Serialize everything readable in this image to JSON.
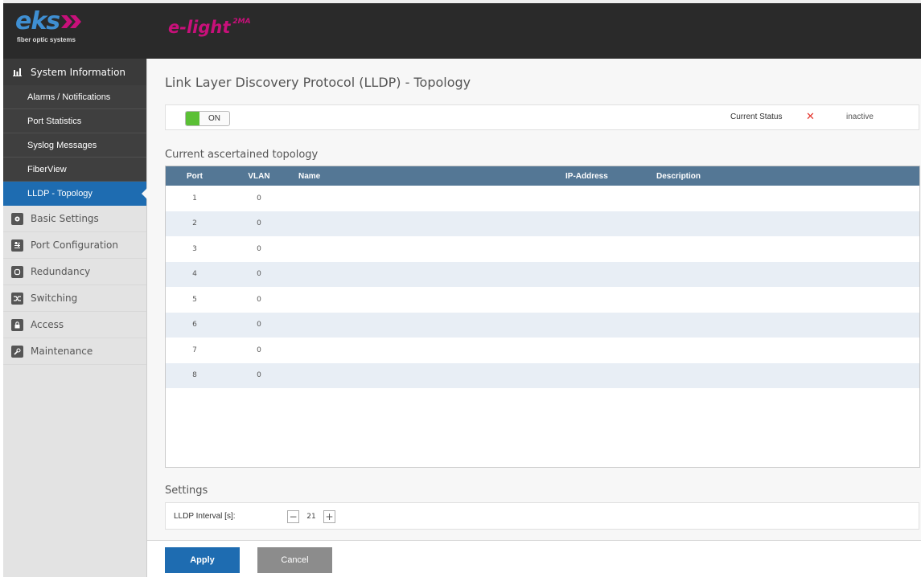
{
  "brand": {
    "logo_text": "eks",
    "logo_tagline": "fiber optic systems",
    "product_name": "e-light",
    "product_suffix": "2MA"
  },
  "sidebar": {
    "sections": [
      {
        "label": "System Information",
        "icon": "bar-chart-icon",
        "active": true
      },
      {
        "label": "Basic Settings",
        "icon": "gear-icon"
      },
      {
        "label": "Port Configuration",
        "icon": "sliders-icon"
      },
      {
        "label": "Redundancy",
        "icon": "loop-icon"
      },
      {
        "label": "Switching",
        "icon": "shuffle-icon"
      },
      {
        "label": "Access",
        "icon": "lock-icon"
      },
      {
        "label": "Maintenance",
        "icon": "wrench-icon"
      }
    ],
    "sub_items": [
      {
        "label": "Alarms / Notifications"
      },
      {
        "label": "Port Statistics"
      },
      {
        "label": "Syslog Messages"
      },
      {
        "label": "FiberView"
      },
      {
        "label": "LLDP - Topology",
        "active": true
      }
    ]
  },
  "page": {
    "title": "Link Layer Discovery Protocol (LLDP) - Topology",
    "toggle_label": "ON",
    "status_label": "Current Status",
    "status_value": "inactive",
    "status_icon": "x-icon"
  },
  "topology": {
    "title": "Current ascertained topology",
    "columns": [
      "Port",
      "VLAN",
      "Name",
      "IP-Address",
      "Description"
    ],
    "rows": [
      {
        "port": "1",
        "vlan": "0",
        "name": "",
        "ip": "",
        "description": ""
      },
      {
        "port": "2",
        "vlan": "0",
        "name": "",
        "ip": "",
        "description": ""
      },
      {
        "port": "3",
        "vlan": "0",
        "name": "",
        "ip": "",
        "description": ""
      },
      {
        "port": "4",
        "vlan": "0",
        "name": "",
        "ip": "",
        "description": ""
      },
      {
        "port": "5",
        "vlan": "0",
        "name": "",
        "ip": "",
        "description": ""
      },
      {
        "port": "6",
        "vlan": "0",
        "name": "",
        "ip": "",
        "description": ""
      },
      {
        "port": "7",
        "vlan": "0",
        "name": "",
        "ip": "",
        "description": ""
      },
      {
        "port": "8",
        "vlan": "0",
        "name": "",
        "ip": "",
        "description": ""
      }
    ]
  },
  "settings": {
    "title": "Settings",
    "interval_label": "LLDP Interval [s]:",
    "interval_value": "21",
    "minus_label": "−",
    "plus_label": "+"
  },
  "actions": {
    "apply_label": "Apply",
    "cancel_label": "Cancel"
  },
  "colors": {
    "accent": "#1e6cb1",
    "table_header": "#547795",
    "toggle_on": "#5bc035",
    "status_error": "#e4332b",
    "brand_magenta": "#c8107a",
    "brand_blue": "#3f8fd2"
  }
}
